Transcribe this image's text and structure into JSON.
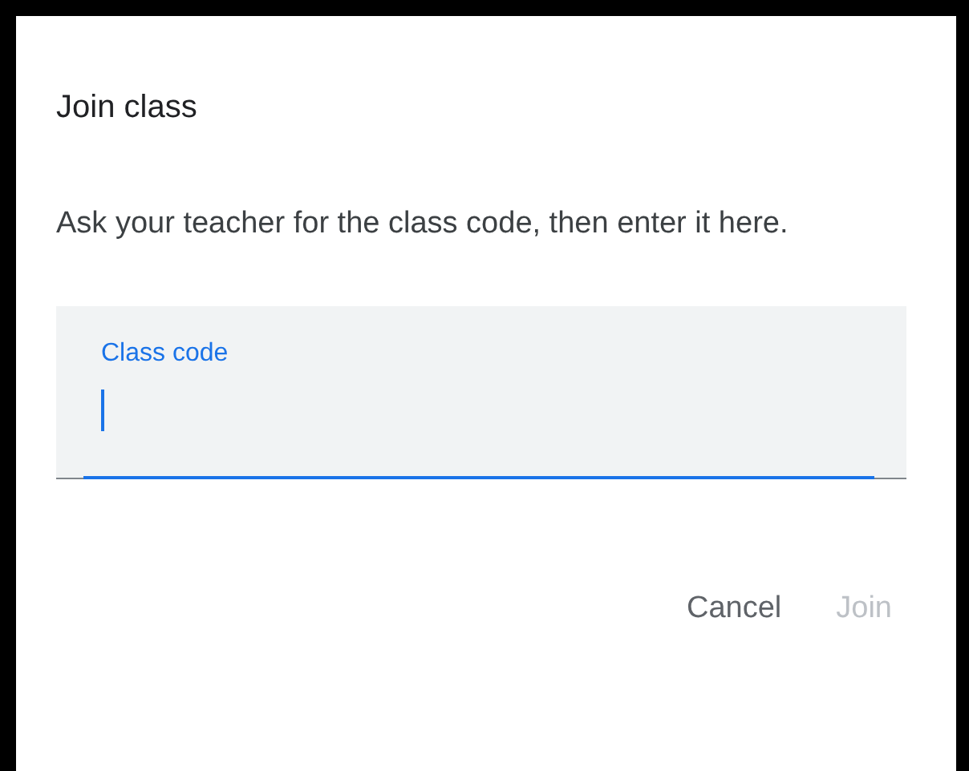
{
  "dialog": {
    "title": "Join class",
    "message": "Ask your teacher for the class code, then enter it here.",
    "field": {
      "label": "Class code",
      "focused": true
    },
    "buttons": [
      {
        "label": "Cancel",
        "disabled": false
      },
      {
        "label": "Join",
        "disabled": true
      }
    ]
  }
}
